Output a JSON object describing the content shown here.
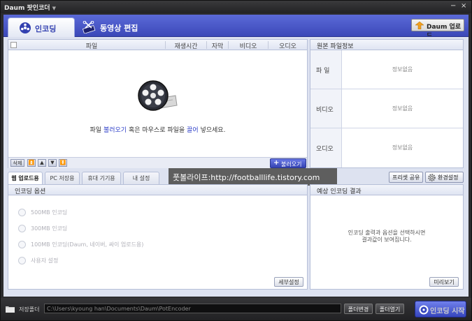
{
  "window": {
    "title": "Daum 팟인코더",
    "menu_arrow": "▼",
    "minimize": "−",
    "close": "×"
  },
  "tabs": {
    "encoding": "인코딩",
    "video_edit": "동영상 편집"
  },
  "daum_upload": "Daum 업로드",
  "file_list": {
    "columns": [
      "파일",
      "재생시간",
      "자막",
      "비디오",
      "오디오"
    ],
    "empty_message_parts": [
      "파일 ",
      "불러오기",
      " 혹은 마우스로 파일을 ",
      "끌어",
      " 넣으세요."
    ],
    "toolbar": {
      "delete": "삭제",
      "move_top": "⏫",
      "move_up": "▲",
      "move_down": "▼",
      "move_bottom": "⏬"
    },
    "open_button": "불러오기",
    "open_plus": "+"
  },
  "source_info": {
    "title": "원본 파일정보",
    "rows": [
      {
        "key": "파  일",
        "value": "정보없음"
      },
      {
        "key": "비디오",
        "value": "정보없음"
      },
      {
        "key": "오디오",
        "value": "정보없음"
      }
    ]
  },
  "option_tabs": [
    "웹 업로드용",
    "PC 저장용",
    "휴대 기기용",
    "내 설정"
  ],
  "watermark_text": "풋볼라이프:http://footballlife.tistory.com",
  "preset_share": "프리셋 공유",
  "env_settings": "환경설정",
  "encoding_options": {
    "title": "인코딩 옵션",
    "items": [
      "500MB 인코딩",
      "300MB 인코딩",
      "100MB 인코딩(Daum, 네이버, 싸이 업로드용)",
      "사용자 설정"
    ],
    "detail_button": "세부설정"
  },
  "expected_result": {
    "title": "예상 인코딩 결과",
    "message_lines": [
      "인코딩 출력과 옵션을 선택하시면",
      "결과값이 보여집니다."
    ],
    "preview_button": "미리보기"
  },
  "status_bar": {
    "save_folder_label": "저장폴더",
    "path": "C:\\Users\\kyoung han\\Documents\\Daum\\PotEncoder",
    "change_folder": "폴더변경",
    "open_folder": "폴더열기",
    "start_button": "인코딩 시작"
  },
  "colors": {
    "accent": "#3b48b8",
    "link": "#2c3ec8",
    "titlebar": "#2c2c2e"
  },
  "icons": {
    "encoding_tab": "film-reel-icon",
    "edit_tab": "scissors-film-icon",
    "daum_upload": "upload-arrow-icon",
    "empty_state": "film-reel-large-icon",
    "env_settings": "gear-icon",
    "status_folder": "folder-icon",
    "start": "start-disc-icon"
  }
}
